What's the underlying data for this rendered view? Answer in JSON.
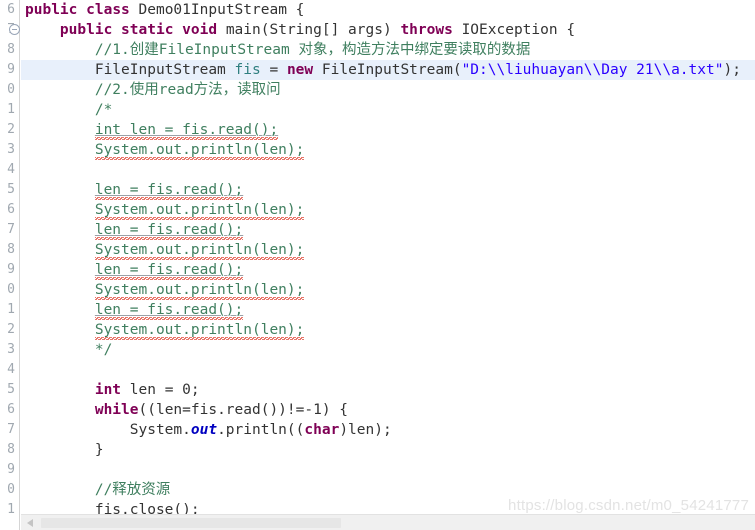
{
  "editor": {
    "language": "java",
    "colors": {
      "keyword": "#7f0055",
      "string": "#2a00ff",
      "comment": "#3f7f5f",
      "plain": "#2b2b2b",
      "static_field": "#0000c0",
      "gutter_number": "#a0a8b0",
      "current_line_highlight": "#e8f0fb",
      "spellcheck_squiggle": "#e04a3a",
      "background": "#ffffff"
    },
    "highlighted_line_index": 3,
    "fold_marker_line_index": 1
  },
  "gutter": {
    "numbers": [
      "6",
      "7",
      "8",
      "9",
      "0",
      "1",
      "2",
      "3",
      "4",
      "5",
      "6",
      "7",
      "8",
      "9",
      "0",
      "1",
      "2",
      "3",
      "4",
      "5",
      "6",
      "7",
      "8",
      "9",
      "0",
      "1"
    ],
    "fold_icon": "collapse-circle-minus-icon"
  },
  "code_lines": [
    {
      "indent": 0,
      "text": "public class Demo01InputStream {"
    },
    {
      "indent": 1,
      "text": "public static void main(String[] args) throws IOException {"
    },
    {
      "indent": 2,
      "text": "//1.创建FileInputStream 对象，构造方法中绑定要读取的数据"
    },
    {
      "indent": 2,
      "text": "FileInputStream fis = new FileInputStream(\"D:\\\\liuhuayan\\\\Day 21\\\\a.txt\");"
    },
    {
      "indent": 2,
      "text": "//2.使用read方法，读取问"
    },
    {
      "indent": 2,
      "text": "/*"
    },
    {
      "indent": 2,
      "text": "int len = fis.read();"
    },
    {
      "indent": 2,
      "text": "System.out.println(len);"
    },
    {
      "indent": 2,
      "text": ""
    },
    {
      "indent": 2,
      "text": "len = fis.read();"
    },
    {
      "indent": 2,
      "text": "System.out.println(len);"
    },
    {
      "indent": 2,
      "text": "len = fis.read();"
    },
    {
      "indent": 2,
      "text": "System.out.println(len);"
    },
    {
      "indent": 2,
      "text": "len = fis.read();"
    },
    {
      "indent": 2,
      "text": "System.out.println(len);"
    },
    {
      "indent": 2,
      "text": "len = fis.read();"
    },
    {
      "indent": 2,
      "text": "System.out.println(len);"
    },
    {
      "indent": 2,
      "text": "*/"
    },
    {
      "indent": 2,
      "text": ""
    },
    {
      "indent": 2,
      "text": "int len = 0;"
    },
    {
      "indent": 2,
      "text": "while((len=fis.read())!=-1) {"
    },
    {
      "indent": 3,
      "text": "System.out.println((char)len);"
    },
    {
      "indent": 2,
      "text": "}"
    },
    {
      "indent": 2,
      "text": ""
    },
    {
      "indent": 2,
      "text": "//释放资源"
    },
    {
      "indent": 2,
      "text": "fis.close();"
    }
  ],
  "tokens": {
    "l0": {
      "kw1": "public",
      "kw2": "class",
      "name": "Demo01InputStream",
      "brace": "{"
    },
    "l1": {
      "kw1": "public",
      "kw2": "static",
      "kw3": "void",
      "name": "main",
      "params": "(String[] args)",
      "kw4": "throws",
      "ex": "IOException",
      "brace": "{"
    },
    "l2": {
      "comment": "//1.创建FileInputStream 对象，构造方法中绑定要读取的数据"
    },
    "l3": {
      "type": "FileInputStream",
      "var": "fis",
      "eq": "=",
      "kw": "new",
      "ctor": "FileInputStream(",
      "string": "\"D:\\\\liuhuayan\\\\Day 21\\\\a.txt\"",
      "tail": ");"
    },
    "l4": {
      "comment": "//2.使用read方法，读取问"
    },
    "l5": {
      "comment": "/*"
    },
    "l6": {
      "comment": "int len = fis.read();"
    },
    "l7": {
      "comment": "System.out.println(len);"
    },
    "l9": {
      "comment": "len = fis.read();"
    },
    "l17": {
      "comment": "*/"
    },
    "l19": {
      "kw": "int",
      "rest": " len = 0;"
    },
    "l20": {
      "kw": "while",
      "rest": "((len=fis.read())!=-1) {"
    },
    "l21": {
      "sys": "System.",
      "out": "out",
      "mid": ".println((",
      "charkw": "char",
      "tail": ")len);"
    },
    "l22": {
      "brace": "}"
    },
    "l24": {
      "comment": "//释放资源"
    },
    "l25": {
      "text": "fis.close();"
    }
  },
  "scrollbar": {
    "orientation": "horizontal",
    "left_arrow_icon": "arrow-left-icon",
    "thumb_position_percent": 0
  },
  "watermark": {
    "text": "https://blog.csdn.net/m0_54241777"
  }
}
